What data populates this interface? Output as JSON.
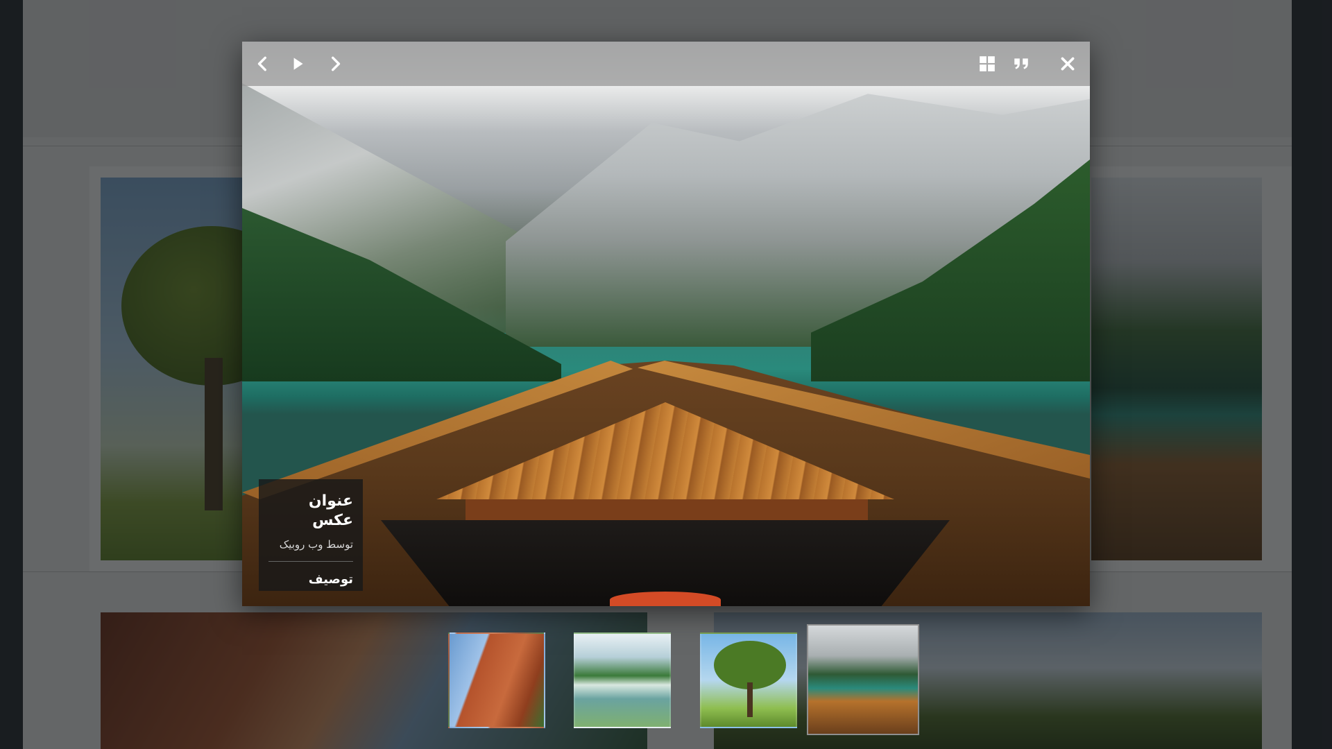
{
  "lightbox": {
    "toolbar": {
      "prev_icon": "chevron-left-icon",
      "play_icon": "play-icon",
      "next_icon": "chevron-right-icon",
      "thumbnails_icon": "grid-icon",
      "caption_icon": "quote-icon",
      "close_icon": "close-icon"
    },
    "caption": {
      "title": "عنوان عکس",
      "subtitle": "توسط وب روبیک",
      "description": "توصیف"
    },
    "thumbnails": [
      {
        "subject": "canyon waterfall"
      },
      {
        "subject": "waterfalls lake"
      },
      {
        "subject": "lone tree"
      },
      {
        "subject": "boat on mountain lake",
        "active": true
      }
    ]
  },
  "colors": {
    "overlay": "#141619",
    "toolbar": "#9b9b9b",
    "caption_bg": "#191919",
    "page_bg": "#e8e8e8",
    "outer_bg": "#24282d"
  }
}
